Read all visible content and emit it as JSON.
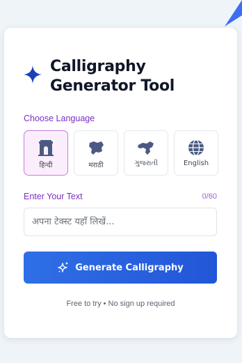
{
  "header": {
    "title": "Calligraphy Generator Tool",
    "icon": "sparkle-icon"
  },
  "language": {
    "label": "Choose Language",
    "selected": "हिन्दी",
    "options": [
      {
        "label": "हिन्दी",
        "icon": "india-gate-icon",
        "active": true
      },
      {
        "label": "मराठी",
        "icon": "maharashtra-map-icon",
        "active": false
      },
      {
        "label": "ગુજરાતી",
        "icon": "gujarat-map-icon",
        "active": false
      },
      {
        "label": "English",
        "icon": "globe-icon",
        "active": false
      }
    ]
  },
  "text_input": {
    "label": "Enter Your Text",
    "counter": "0/60",
    "placeholder": "अपना टेक्स्ट यहाँ लिखें...",
    "value": ""
  },
  "generate_button": {
    "label": "Generate Calligraphy",
    "icon": "sparkles-icon"
  },
  "footnote": "Free to try • No sign up required",
  "colors": {
    "accent_purple": "#7a2fc4",
    "button_blue": "#2563eb",
    "active_bg": "#fbeefc",
    "icon_slate": "#4b5a82"
  }
}
